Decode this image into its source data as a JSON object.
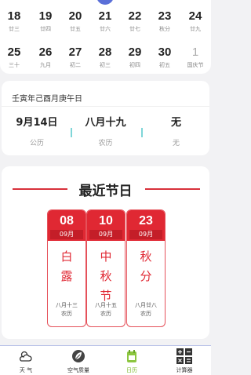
{
  "calendar": {
    "row1": [
      {
        "day": "18",
        "sub": "廿三"
      },
      {
        "day": "19",
        "sub": "廿四"
      },
      {
        "day": "20",
        "sub": "廿五"
      },
      {
        "day": "21",
        "sub": "廿六"
      },
      {
        "day": "22",
        "sub": "廿七"
      },
      {
        "day": "23",
        "sub": "秋分"
      },
      {
        "day": "24",
        "sub": "廿九"
      }
    ],
    "row2": [
      {
        "day": "25",
        "sub": "三十"
      },
      {
        "day": "26",
        "sub": "九月"
      },
      {
        "day": "27",
        "sub": "初二"
      },
      {
        "day": "28",
        "sub": "初三"
      },
      {
        "day": "29",
        "sub": "初四"
      },
      {
        "day": "30",
        "sub": "初五"
      },
      {
        "day": "1",
        "sub": "国庆节"
      }
    ]
  },
  "info": {
    "ganzhi": "壬寅年己酉月庚午日",
    "solar_value": "9月14日",
    "solar_label": "公历",
    "lunar_value": "八月十九",
    "lunar_label": "农历",
    "extra_value": "无",
    "extra_label": "无"
  },
  "festivals": {
    "title": "最近节日",
    "items": [
      {
        "day": "08",
        "month": "09月",
        "name": [
          "白",
          "露"
        ],
        "lunar": [
          "八月十三",
          "农历"
        ]
      },
      {
        "day": "10",
        "month": "09月",
        "name": [
          "中",
          "秋",
          "节"
        ],
        "lunar": [
          "八月十五",
          "农历"
        ]
      },
      {
        "day": "23",
        "month": "09月",
        "name": [
          "秋",
          "分"
        ],
        "lunar": [
          "八月廿八",
          "农历"
        ]
      }
    ]
  },
  "nav": {
    "weather": "天 气",
    "air": "空气质量",
    "calendar": "日历",
    "calculator": "计算器"
  }
}
